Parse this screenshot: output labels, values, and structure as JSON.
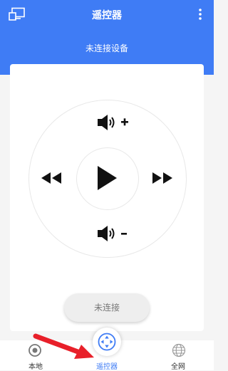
{
  "header": {
    "title": "遥控器",
    "subtitle": "未连接设备",
    "cast_icon": "screen-cast-icon",
    "more_icon": "more-vertical-icon"
  },
  "remote": {
    "volume_up_icon": "volume-up-icon",
    "volume_down_icon": "volume-down-icon",
    "rewind_icon": "rewind-icon",
    "fast_forward_icon": "fast-forward-icon",
    "play_icon": "play-icon",
    "connect_label": "未连接"
  },
  "nav": {
    "items": [
      {
        "label": "本地",
        "icon": "local-record-icon"
      },
      {
        "label": "遥控器",
        "icon": "remote-control-icon",
        "active": true
      },
      {
        "label": "全网",
        "icon": "globe-icon"
      }
    ]
  },
  "colors": {
    "primary": "#3f7cf5",
    "arrow": "#e8202a"
  }
}
